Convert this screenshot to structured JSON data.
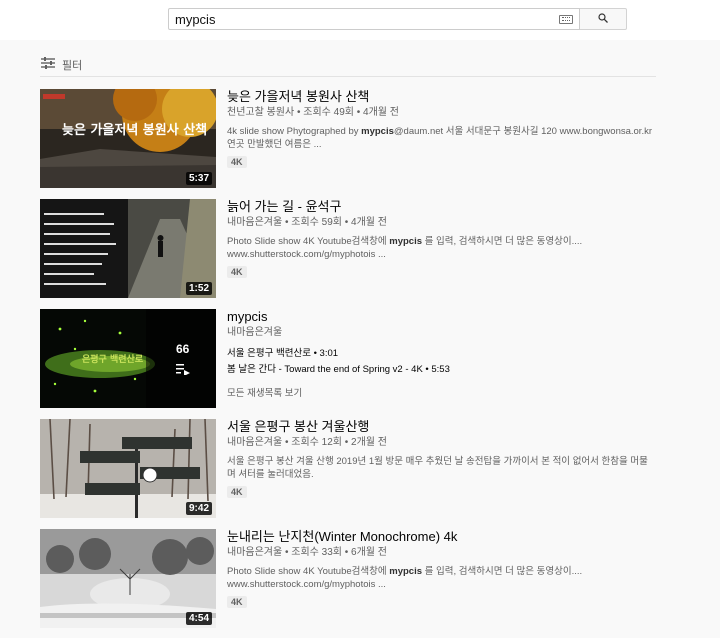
{
  "search": {
    "query": "mypcis"
  },
  "filter": {
    "label": "필터"
  },
  "results": [
    {
      "title": "늦은 가을저녁 봉원사 산책",
      "channel": "천년고찰 봉원사",
      "views": "조회수 49회",
      "age": "4개월 전",
      "description": [
        {
          "text": "4k slide show Phytographed by "
        },
        {
          "text": "mypcis",
          "bold": true
        },
        {
          "text": "@daum.net 서울 서대문구 봉원사길 120 www.bongwonsa.or.kr 연곳 만발했던 여름은 ..."
        }
      ],
      "badge": "4K",
      "duration": "5:37",
      "thumb_text": "늦은 가을저녁 봉원사 산책"
    },
    {
      "title": "늙어 가는 길 - 윤석구",
      "channel": "내마음은겨울",
      "views": "조회수 59회",
      "age": "4개월 전",
      "description": [
        {
          "text": "Photo Slide show 4K Youtube검색창에 "
        },
        {
          "text": "mypcis",
          "bold": true
        },
        {
          "text": " 를 입력, 검색하시면 더 많은 동영상이.... www.shutterstock.com/g/myphotois ..."
        }
      ],
      "badge": "4K",
      "duration": "1:52"
    },
    {
      "title": "mypcis",
      "channel": "내마음은겨울",
      "playlist": {
        "count": "66",
        "items": [
          "서울 은평구 백련산로 • 3:01",
          "봄 날은 간다 - Toward the end of Spring v2 - 4K • 5:53"
        ],
        "view_all": "모든 재생목록 보기"
      },
      "thumb_text": "은평구 백련산로"
    },
    {
      "title": "서울 은평구 봉산 겨울산행",
      "channel": "내마음은겨울",
      "views": "조회수 12회",
      "age": "2개월 전",
      "description": [
        {
          "text": "서울 은평구 봉산 겨울 산행 2019년 1월 방문 매우 추웠던 날 송전탑을 가까이서 본 적이 없어서 한참을 머물며 셔터를 눌러대었음."
        }
      ],
      "badge": "4K",
      "duration": "9:42"
    },
    {
      "title": "눈내리는 난지천(Winter Monochrome) 4k",
      "channel": "내마음은겨울",
      "views": "조회수 33회",
      "age": "6개월 전",
      "description": [
        {
          "text": "Photo Slide show 4K Youtube검색창에 "
        },
        {
          "text": "mypcis",
          "bold": true
        },
        {
          "text": " 를 입력, 검색하시면 더 많은 동영상이.... www.shutterstock.com/g/myphotois ..."
        }
      ],
      "badge": "4K",
      "duration": "4:54"
    }
  ],
  "colors": {
    "accent": "#065fd4",
    "text": "#030303",
    "meta": "#606060",
    "bg": "#f9f9f9"
  }
}
